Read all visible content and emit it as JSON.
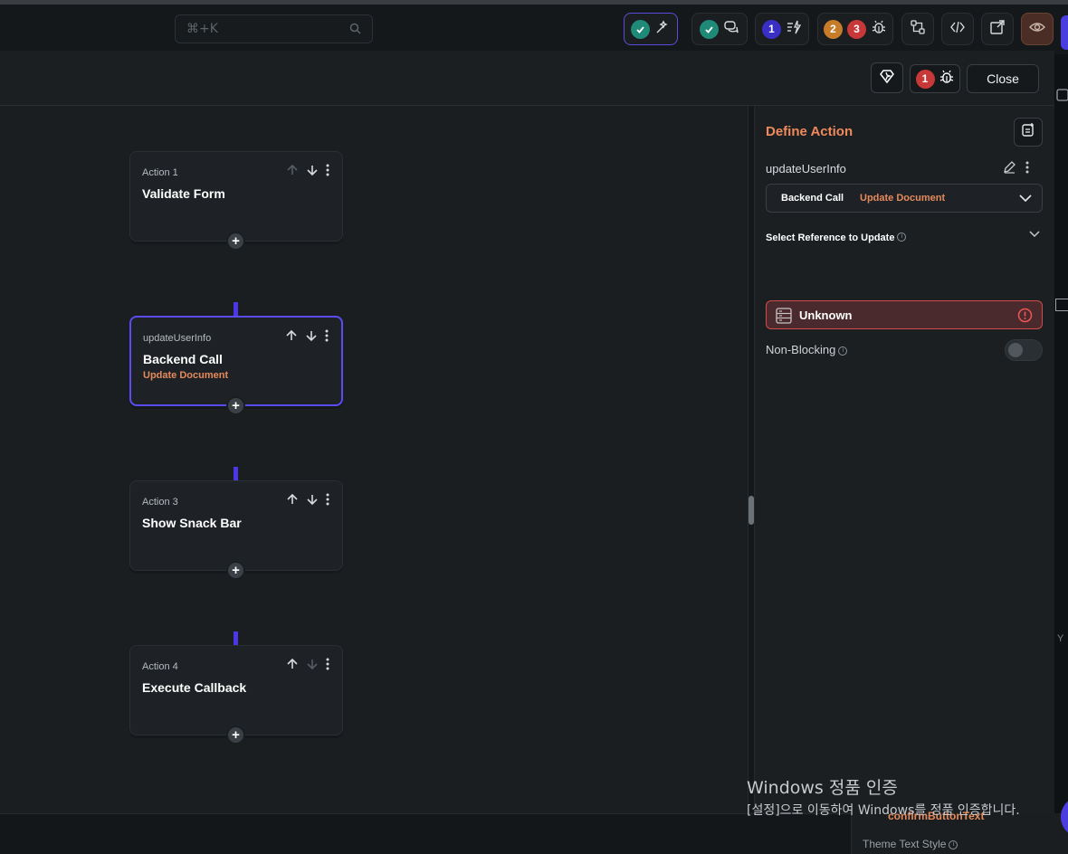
{
  "topbar": {
    "search_shortcut": "⌘+K",
    "badges": {
      "count_blue": "1",
      "count_orange": "2",
      "count_red": "3"
    }
  },
  "modal": {
    "bug_count": "1",
    "close_label": "Close"
  },
  "flow": {
    "actions": [
      {
        "label": "Action 1",
        "title": "Validate Form",
        "subtitle": ""
      },
      {
        "label": "updateUserInfo",
        "title": "Backend Call",
        "subtitle": "Update Document"
      },
      {
        "label": "Action 3",
        "title": "Show Snack Bar",
        "subtitle": ""
      },
      {
        "label": "Action 4",
        "title": "Execute Callback",
        "subtitle": ""
      }
    ]
  },
  "define_action": {
    "heading": "Define Action",
    "action_name": "updateUserInfo",
    "type_primary": "Backend Call",
    "type_secondary": "Update Document",
    "reference_label": "Select Reference to Update",
    "reference_value": "Unknown",
    "non_blocking_label": "Non-Blocking"
  },
  "bottom_panel": {
    "field_name": "confirmButtonText",
    "theme_label": "Theme Text Style"
  },
  "watermark": {
    "line1": "Windows 정품 인증",
    "line2": "[설정]으로 이동하여 Windows를 정품 인증합니다."
  },
  "colors": {
    "accent": "#4a38e8",
    "orange": "#ef8a5c",
    "error": "#d24b4b"
  }
}
